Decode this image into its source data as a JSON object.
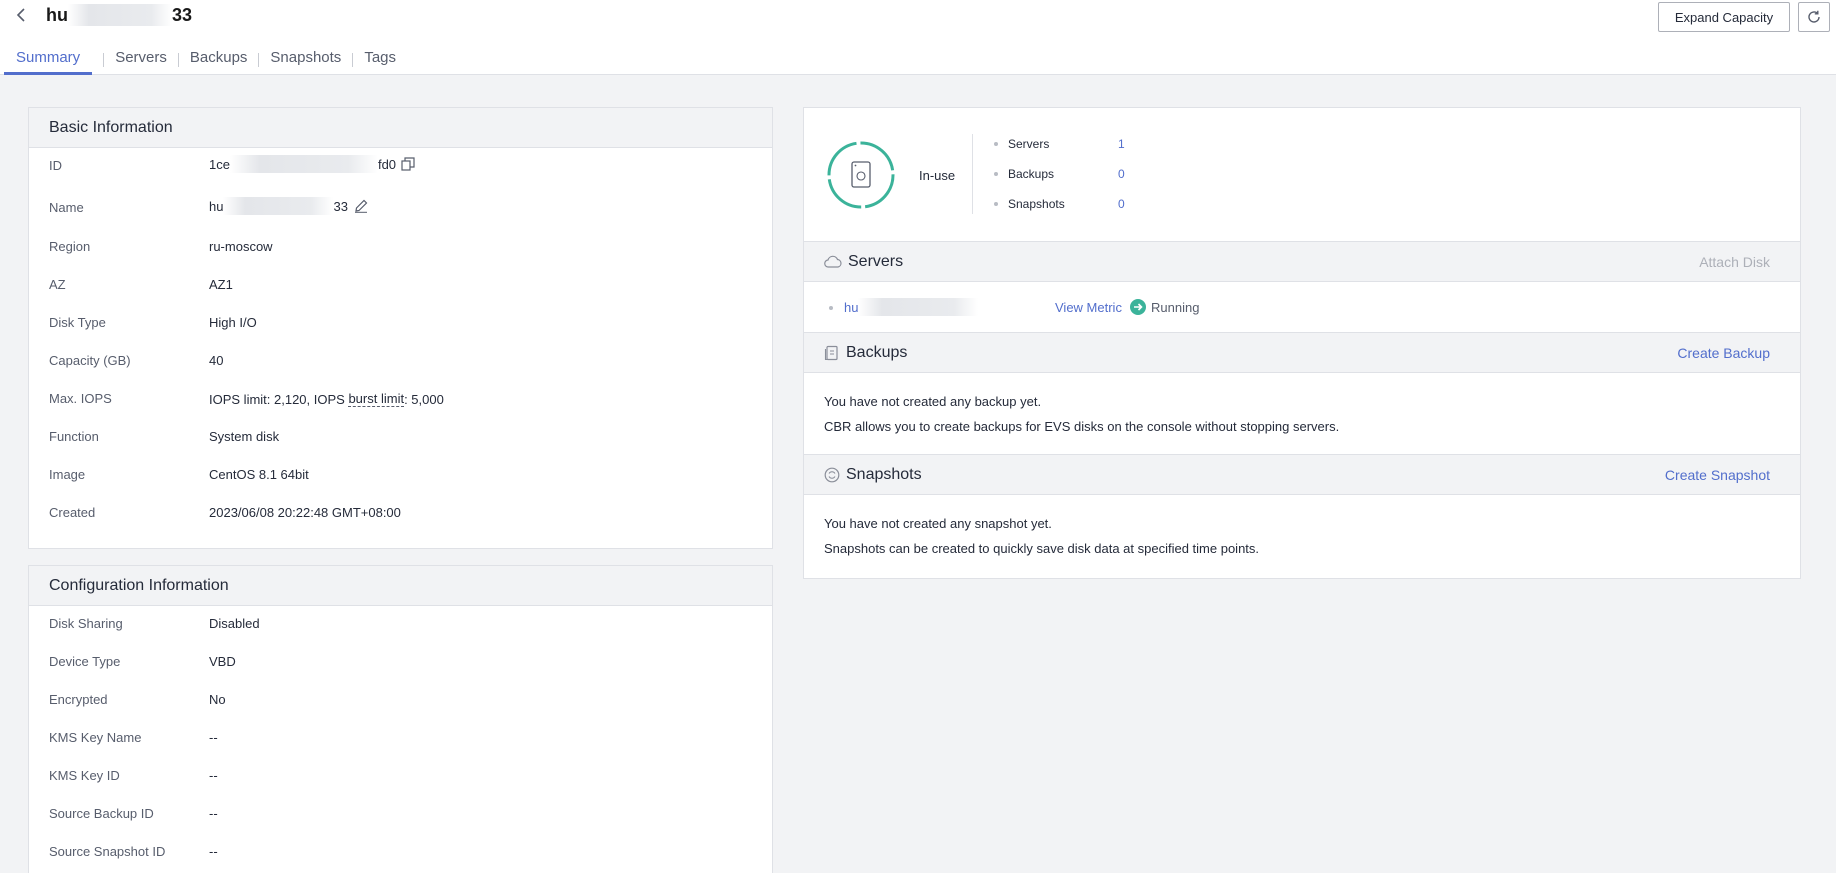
{
  "header": {
    "title_prefix": "hu",
    "title_suffix": "33",
    "expand_button": "Expand Capacity"
  },
  "tabs": [
    "Summary",
    "Servers",
    "Backups",
    "Snapshots",
    "Tags"
  ],
  "basic": {
    "title": "Basic Information",
    "id_label": "ID",
    "id_prefix": "1ce",
    "id_suffix": "fd0",
    "name_label": "Name",
    "name_prefix": "hu",
    "name_suffix": "33",
    "rows": [
      {
        "label": "Region",
        "value": "ru-moscow"
      },
      {
        "label": "AZ",
        "value": "AZ1"
      },
      {
        "label": "Disk Type",
        "value": "High I/O"
      },
      {
        "label": "Capacity (GB)",
        "value": "40"
      }
    ],
    "iops_label": "Max. IOPS",
    "iops_part1": "IOPS limit: 2,120, IOPS ",
    "iops_burst": "burst limit",
    "iops_part2": ": 5,000",
    "rows2": [
      {
        "label": "Function",
        "value": "System disk"
      },
      {
        "label": "Image",
        "value": "CentOS 8.1 64bit"
      },
      {
        "label": "Created",
        "value": "2023/06/08 20:22:48 GMT+08:00"
      }
    ]
  },
  "config": {
    "title": "Configuration Information",
    "rows": [
      {
        "label": "Disk Sharing",
        "value": "Disabled"
      },
      {
        "label": "Device Type",
        "value": "VBD"
      },
      {
        "label": "Encrypted",
        "value": "No"
      },
      {
        "label": "KMS Key Name",
        "value": "--"
      },
      {
        "label": "KMS Key ID",
        "value": "--"
      },
      {
        "label": "Source Backup ID",
        "value": "--"
      },
      {
        "label": "Source Snapshot ID",
        "value": "--"
      }
    ]
  },
  "status": {
    "label": "In-use",
    "ring_color": "#3bb39a",
    "stats": [
      {
        "label": "Servers",
        "value": "1"
      },
      {
        "label": "Backups",
        "value": "0"
      },
      {
        "label": "Snapshots",
        "value": "0"
      }
    ]
  },
  "servers": {
    "title": "Servers",
    "attach": "Attach Disk",
    "server_prefix": "hu",
    "server_suffix": "",
    "view_metric": "View Metric",
    "state": "Running"
  },
  "backups": {
    "title": "Backups",
    "create": "Create Backup",
    "line1": "You have not created any backup yet.",
    "line2": "CBR allows you to create backups for EVS disks on the console without stopping servers."
  },
  "snapshots": {
    "title": "Snapshots",
    "create": "Create Snapshot",
    "line1": "You have not created any snapshot yet.",
    "line2": "Snapshots can be created to quickly save disk data at specified time points."
  }
}
